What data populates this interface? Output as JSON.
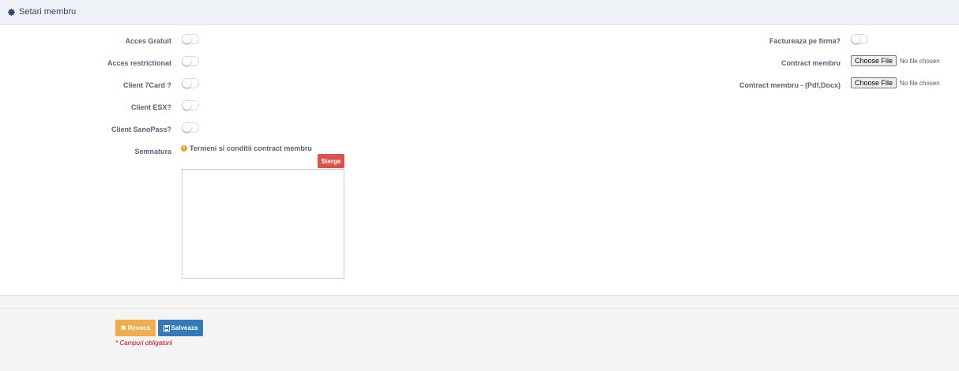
{
  "header": {
    "title": "Setari membru",
    "icon": "gear-icon"
  },
  "left_fields": [
    {
      "label": "Acces Gratuit",
      "checked": false
    },
    {
      "label": "Acces restrictionat",
      "checked": false
    },
    {
      "label": "Client 7Card ?",
      "checked": false
    },
    {
      "label": "Client ESX?",
      "checked": false
    },
    {
      "label": "Client SanoPass?",
      "checked": false
    }
  ],
  "signature": {
    "label": "Semnatura",
    "terms_text": "Termeni si conditii contract membru",
    "clear_label": "Sterge"
  },
  "right_fields": {
    "factureaza_label": "Factureaza pe firma?",
    "factureaza_checked": false,
    "contract_label": "Contract membru",
    "contract_pdf_label": "Contract membru - (Pdf,Docx)",
    "choose_file": "Choose File",
    "no_file": "No file chosen"
  },
  "footer": {
    "revoca_label": "Revoca",
    "salveaza_label": "Salveaza",
    "required_note": "* Campuri obligatorii"
  },
  "colors": {
    "revoca": "#f0ad4e",
    "salveaza": "#337ab7",
    "sterge": "#d9534f",
    "required": "#cc0000"
  }
}
